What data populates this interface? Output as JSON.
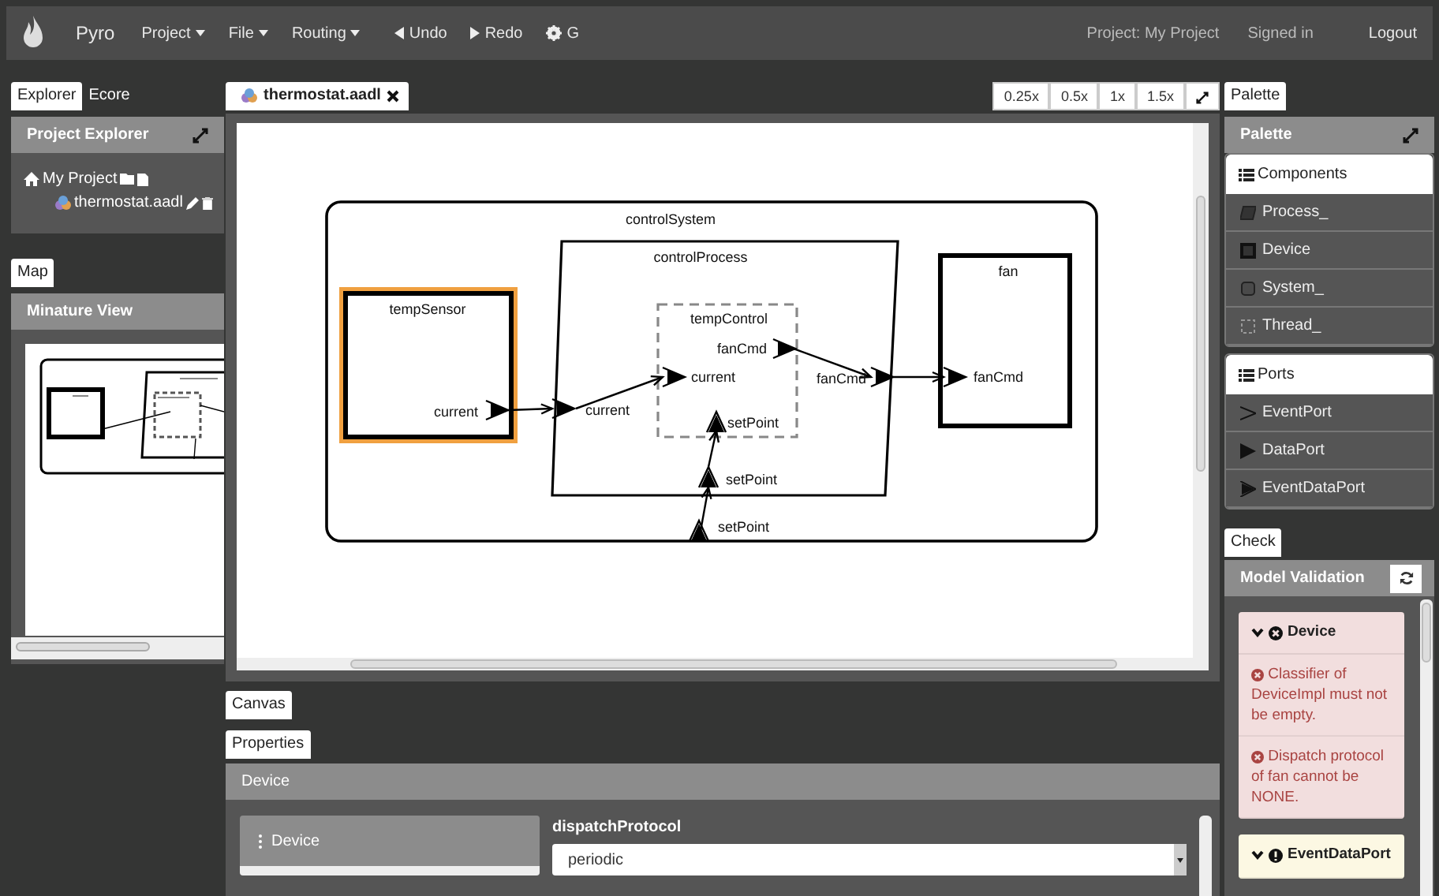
{
  "navbar": {
    "brand": "Pyro",
    "menus": [
      {
        "label": "Project",
        "kind": "dropdown"
      },
      {
        "label": "File",
        "kind": "dropdown"
      },
      {
        "label": "Routing",
        "kind": "dropdown"
      },
      {
        "label": "Undo",
        "kind": "undo"
      },
      {
        "label": "Redo",
        "kind": "redo"
      },
      {
        "label": "G",
        "kind": "settings"
      }
    ],
    "project": "Project: My Project",
    "user": "Signed in",
    "logout": "Logout"
  },
  "left": {
    "tabs": [
      {
        "label": "Explorer",
        "selected": true
      },
      {
        "label": "Ecore",
        "selected": false
      }
    ],
    "explorer_title": "Project Explorer",
    "tree": [
      {
        "name": "My Project",
        "children": [
          {
            "name": "thermostat.aadl"
          }
        ]
      }
    ],
    "map_tabs": [
      {
        "label": "Map",
        "selected": true
      }
    ],
    "map_title": "Minature View"
  },
  "editor": {
    "tabs": [
      {
        "label": "thermostat.aadl",
        "selected": true
      }
    ],
    "zoom": [
      "0.25x",
      "0.5x",
      "1x",
      "1.5x"
    ],
    "components": [
      {
        "name": "controlSystem",
        "kind": "system",
        "selected": false,
        "ports": [
          {
            "name": "setPoint"
          }
        ]
      },
      {
        "name": "controlProcess",
        "kind": "process",
        "selected": false,
        "ports": [
          {
            "name": "current"
          },
          {
            "name": "fanCmd"
          },
          {
            "name": "setPoint"
          }
        ]
      },
      {
        "name": "tempControl",
        "kind": "thread",
        "selected": false,
        "ports": [
          {
            "name": "fanCmd"
          },
          {
            "name": "current"
          },
          {
            "name": "setPoint"
          }
        ]
      },
      {
        "name": "tempSensor",
        "kind": "device",
        "selected": true,
        "ports": [
          {
            "name": "current"
          }
        ]
      },
      {
        "name": "fan",
        "kind": "device",
        "selected": false,
        "ports": [
          {
            "name": "fanCmd"
          }
        ]
      }
    ]
  },
  "bottom": {
    "canvas_tabs": [
      {
        "label": "Canvas",
        "selected": true
      }
    ],
    "prop_tabs": [
      {
        "label": "Properties",
        "selected": true
      }
    ],
    "title": "Device",
    "items": [
      {
        "label": "Device",
        "selected": true
      }
    ],
    "fields": [
      {
        "label": "dispatchProtocol",
        "value": "periodic"
      }
    ]
  },
  "palette": {
    "tabs": [
      {
        "label": "Palette",
        "selected": true
      }
    ],
    "title": "Palette",
    "groups": [
      {
        "title": "Components",
        "items": [
          {
            "label": "Process_",
            "kind": "process"
          },
          {
            "label": "Device",
            "kind": "device"
          },
          {
            "label": "System_",
            "kind": "system"
          },
          {
            "label": "Thread_",
            "kind": "thread"
          }
        ]
      },
      {
        "title": "Ports",
        "items": [
          {
            "label": "EventPort",
            "kind": "event"
          },
          {
            "label": "DataPort",
            "kind": "data"
          },
          {
            "label": "EventDataPort",
            "kind": "eventdata"
          }
        ]
      }
    ]
  },
  "check": {
    "tabs": [
      {
        "label": "Check",
        "selected": true
      }
    ],
    "title": "Model Validation",
    "groups": [
      {
        "title": "Device",
        "kind": "error",
        "messages": [
          "Classifier of DeviceImpl must not be empty.",
          "Dispatch protocol of fan cannot be NONE."
        ]
      },
      {
        "title": "EventDataPort",
        "kind": "warning"
      }
    ]
  }
}
